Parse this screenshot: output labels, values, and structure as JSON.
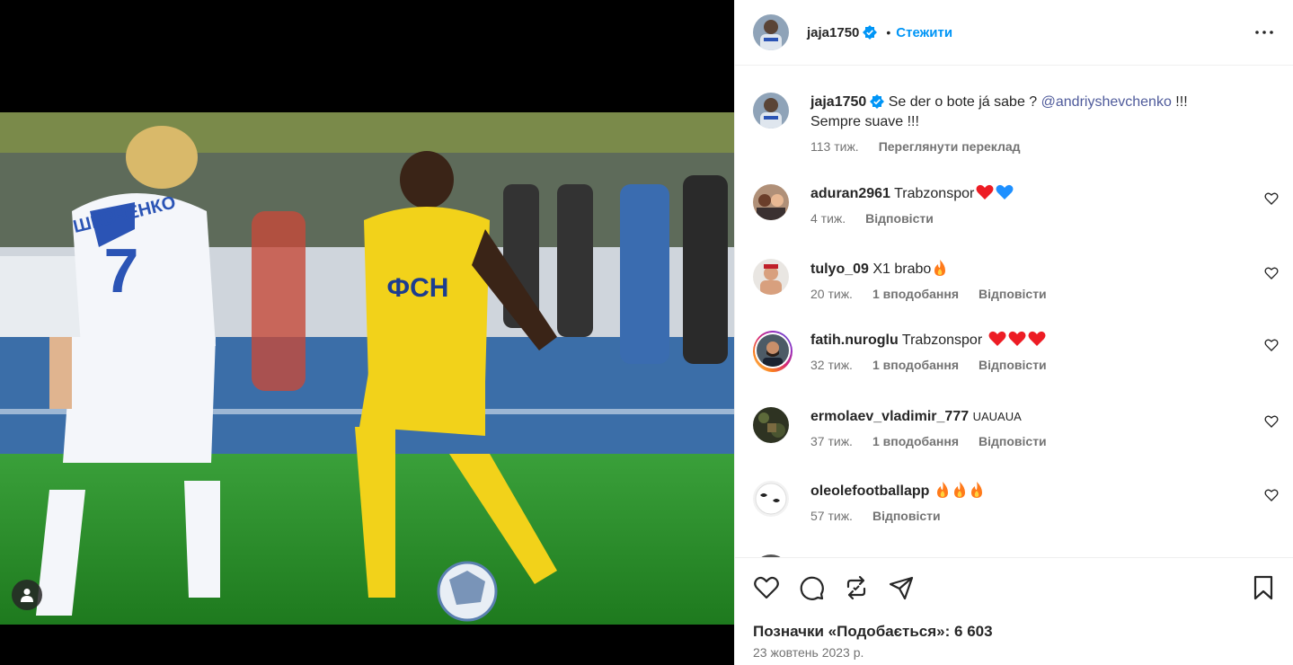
{
  "post": {
    "username": "jaja1750",
    "follow_label": "Стежити",
    "dot": "•",
    "caption_text": "Se der o bote já sabe ? ",
    "caption_mention": "@andriyshevchenko",
    "caption_tail": " !!!",
    "caption_line2": "Sempre suave !!!",
    "caption_time": "113 тиж.",
    "translate_label": "Переглянути переклад",
    "photo_jersey_number": "7",
    "photo_jersey_name": "ШЕВЧЕНКО",
    "photo_sponsor": "ФСН"
  },
  "comments": [
    {
      "username": "aduran2961",
      "text": "Trabzonspor",
      "emoji": [
        "red-heart",
        "blue-heart"
      ],
      "time": "4 тиж.",
      "likes": "",
      "reply": "Відповісти"
    },
    {
      "username": "tulyo_09",
      "text": "X1 brabo",
      "emoji": [
        "fire"
      ],
      "time": "20 тиж.",
      "likes": "1 вподобання",
      "reply": "Відповісти"
    },
    {
      "username": "fatih.nuroglu",
      "text": "Trabzonspor",
      "emoji": [
        "red-heart",
        "red-heart",
        "red-heart"
      ],
      "time": "32 тиж.",
      "likes": "1 вподобання",
      "reply": "Відповісти"
    },
    {
      "username": "ermolaev_vladimir_777",
      "text": "UAUAUA",
      "emoji": [],
      "time": "37 тиж.",
      "likes": "1 вподобання",
      "reply": "Відповісти"
    },
    {
      "username": "oleolefootballapp",
      "text": "",
      "emoji": [
        "fire",
        "fire",
        "fire"
      ],
      "time": "57 тиж.",
      "likes": "",
      "reply": "Відповісти"
    }
  ],
  "footer": {
    "likes_label": "Позначки «Подобається»: 6 603",
    "date": "23 жовтень 2023 р."
  },
  "colors": {
    "accent": "#0095f6",
    "verified": "#0095f6",
    "heart": "#ed1c24",
    "blue_heart": "#1e90ff",
    "mention": "#4f5b9b"
  },
  "icons": [
    "more-options-icon",
    "like-icon",
    "comment-icon",
    "repost-icon",
    "share-icon",
    "save-icon",
    "user-tag-icon",
    "verified-badge-icon"
  ]
}
